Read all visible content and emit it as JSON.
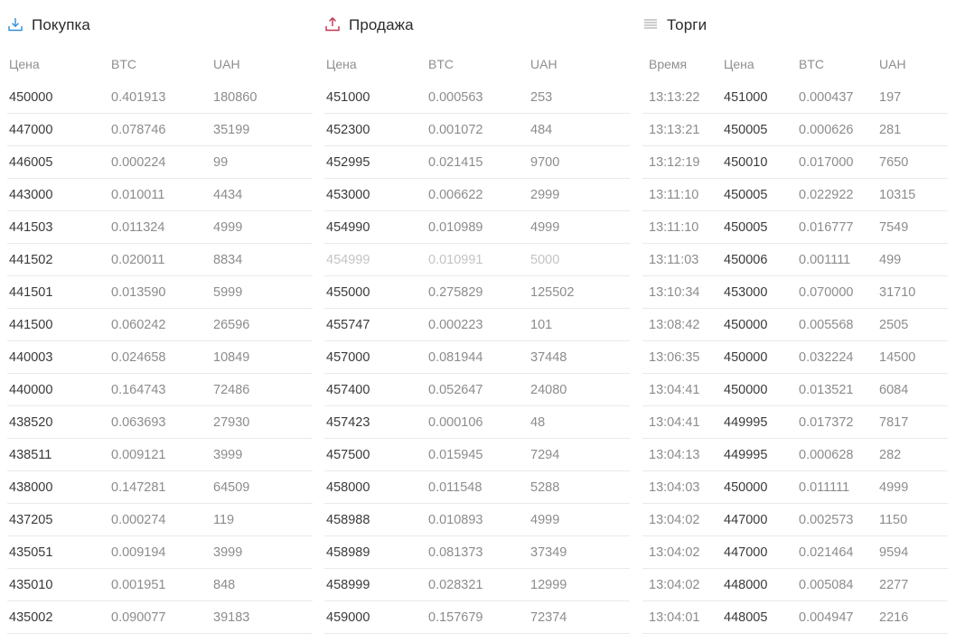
{
  "buy": {
    "title": "Покупка",
    "icon": "download-icon",
    "icon_color": "#2f8fd6",
    "columns": [
      "Цена",
      "BTC",
      "UAH"
    ],
    "rows": [
      [
        "450000",
        "0.401913",
        "180860"
      ],
      [
        "447000",
        "0.078746",
        "35199"
      ],
      [
        "446005",
        "0.000224",
        "99"
      ],
      [
        "443000",
        "0.010011",
        "4434"
      ],
      [
        "441503",
        "0.011324",
        "4999"
      ],
      [
        "441502",
        "0.020011",
        "8834"
      ],
      [
        "441501",
        "0.013590",
        "5999"
      ],
      [
        "441500",
        "0.060242",
        "26596"
      ],
      [
        "440003",
        "0.024658",
        "10849"
      ],
      [
        "440000",
        "0.164743",
        "72486"
      ],
      [
        "438520",
        "0.063693",
        "27930"
      ],
      [
        "438511",
        "0.009121",
        "3999"
      ],
      [
        "438000",
        "0.147281",
        "64509"
      ],
      [
        "437205",
        "0.000274",
        "119"
      ],
      [
        "435051",
        "0.009194",
        "3999"
      ],
      [
        "435010",
        "0.001951",
        "848"
      ],
      [
        "435002",
        "0.090077",
        "39183"
      ]
    ]
  },
  "sell": {
    "title": "Продажа",
    "icon": "upload-icon",
    "icon_color": "#c0334f",
    "columns": [
      "Цена",
      "BTC",
      "UAH"
    ],
    "faded_row_index": 5,
    "rows": [
      [
        "451000",
        "0.000563",
        "253"
      ],
      [
        "452300",
        "0.001072",
        "484"
      ],
      [
        "452995",
        "0.021415",
        "9700"
      ],
      [
        "453000",
        "0.006622",
        "2999"
      ],
      [
        "454990",
        "0.010989",
        "4999"
      ],
      [
        "454999",
        "0.010991",
        "5000"
      ],
      [
        "455000",
        "0.275829",
        "125502"
      ],
      [
        "455747",
        "0.000223",
        "101"
      ],
      [
        "457000",
        "0.081944",
        "37448"
      ],
      [
        "457400",
        "0.052647",
        "24080"
      ],
      [
        "457423",
        "0.000106",
        "48"
      ],
      [
        "457500",
        "0.015945",
        "7294"
      ],
      [
        "458000",
        "0.011548",
        "5288"
      ],
      [
        "458988",
        "0.010893",
        "4999"
      ],
      [
        "458989",
        "0.081373",
        "37349"
      ],
      [
        "458999",
        "0.028321",
        "12999"
      ],
      [
        "459000",
        "0.157679",
        "72374"
      ]
    ]
  },
  "trades": {
    "title": "Торги",
    "icon": "list-icon",
    "icon_color": "#9a9a9a",
    "columns": [
      "Время",
      "Цена",
      "BTC",
      "UAH"
    ],
    "rows": [
      [
        "13:13:22",
        "451000",
        "0.000437",
        "197"
      ],
      [
        "13:13:21",
        "450005",
        "0.000626",
        "281"
      ],
      [
        "13:12:19",
        "450010",
        "0.017000",
        "7650"
      ],
      [
        "13:11:10",
        "450005",
        "0.022922",
        "10315"
      ],
      [
        "13:11:10",
        "450005",
        "0.016777",
        "7549"
      ],
      [
        "13:11:03",
        "450006",
        "0.001111",
        "499"
      ],
      [
        "13:10:34",
        "453000",
        "0.070000",
        "31710"
      ],
      [
        "13:08:42",
        "450000",
        "0.005568",
        "2505"
      ],
      [
        "13:06:35",
        "450000",
        "0.032224",
        "14500"
      ],
      [
        "13:04:41",
        "450000",
        "0.013521",
        "6084"
      ],
      [
        "13:04:41",
        "449995",
        "0.017372",
        "7817"
      ],
      [
        "13:04:13",
        "449995",
        "0.000628",
        "282"
      ],
      [
        "13:04:03",
        "450000",
        "0.011111",
        "4999"
      ],
      [
        "13:04:02",
        "447000",
        "0.002573",
        "1150"
      ],
      [
        "13:04:02",
        "447000",
        "0.021464",
        "9594"
      ],
      [
        "13:04:02",
        "448000",
        "0.005084",
        "2277"
      ],
      [
        "13:04:01",
        "448005",
        "0.004947",
        "2216"
      ]
    ]
  }
}
